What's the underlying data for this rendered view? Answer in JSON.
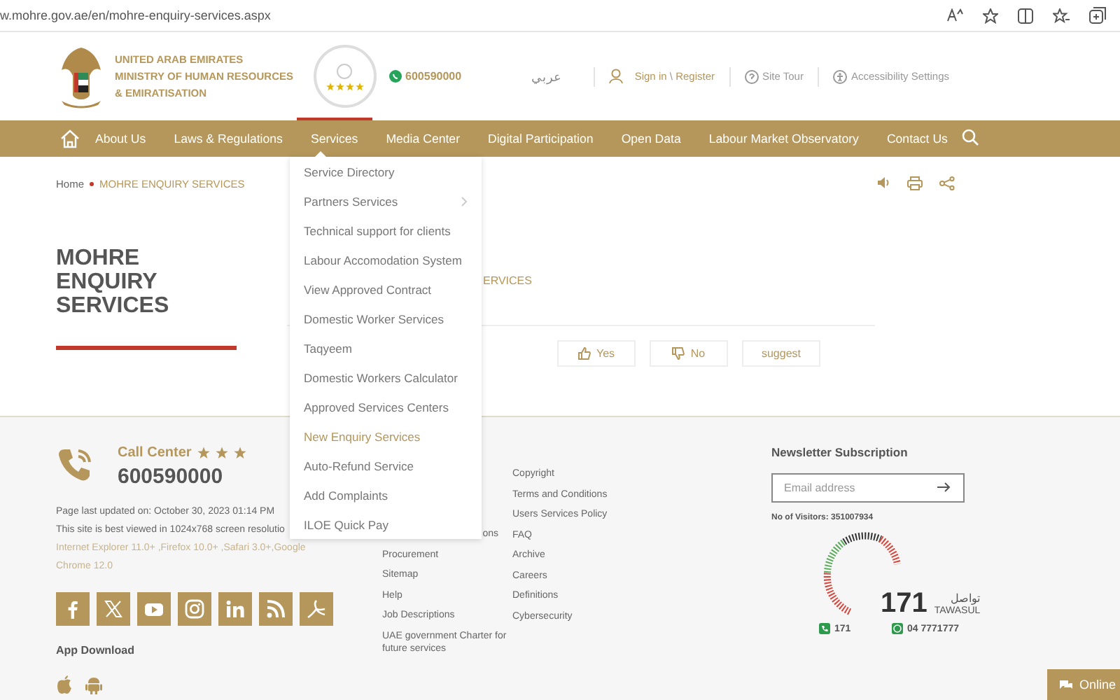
{
  "browser": {
    "url": "w.mohre.gov.ae/en/mohre-enquiry-services.aspx"
  },
  "header": {
    "ministry_lines": [
      "UNITED ARAB EMIRATES",
      "MINISTRY OF HUMAN RESOURCES",
      "& EMIRATISATION"
    ],
    "badge": {
      "stars": 4
    },
    "phone": "600590000",
    "language": "عربي",
    "sign_in": "Sign in",
    "separator": "\\",
    "register": "Register",
    "site_tour": "Site Tour",
    "accessibility": "Accessibility Settings"
  },
  "nav": {
    "items": [
      {
        "label": "About Us",
        "selected": false
      },
      {
        "label": "Laws & Regulations",
        "selected": false
      },
      {
        "label": "Services",
        "selected": true
      },
      {
        "label": "Media Center",
        "selected": false
      },
      {
        "label": "Digital Participation",
        "selected": false
      },
      {
        "label": "Open Data",
        "selected": false
      },
      {
        "label": "Labour Market Observatory",
        "selected": false
      },
      {
        "label": "Contact Us",
        "selected": false
      }
    ],
    "dropdown": [
      {
        "label": "Service Directory",
        "selected": false,
        "has_submenu": false
      },
      {
        "label": "Partners Services",
        "selected": false,
        "has_submenu": true
      },
      {
        "label": "Technical support for clients",
        "selected": false,
        "has_submenu": false
      },
      {
        "label": "Labour Accomodation System",
        "selected": false,
        "has_submenu": false
      },
      {
        "label": "View Approved Contract",
        "selected": false,
        "has_submenu": false
      },
      {
        "label": "Domestic Worker Services",
        "selected": false,
        "has_submenu": false
      },
      {
        "label": "Taqyeem",
        "selected": false,
        "has_submenu": false
      },
      {
        "label": "Domestic Workers Calculator",
        "selected": false,
        "has_submenu": false
      },
      {
        "label": "Approved Services Centers",
        "selected": false,
        "has_submenu": false
      },
      {
        "label": "New Enquiry Services",
        "selected": true,
        "has_submenu": false
      },
      {
        "label": "Auto-Refund Service",
        "selected": false,
        "has_submenu": false
      },
      {
        "label": "Add Complaints",
        "selected": false,
        "has_submenu": false
      },
      {
        "label": "ILOE Quick Pay",
        "selected": false,
        "has_submenu": false
      }
    ]
  },
  "breadcrumb": {
    "home": "Home",
    "current": "MOHRE ENQUIRY SERVICES"
  },
  "page": {
    "title_lines": [
      "MOHRE",
      "ENQUIRY",
      "SERVICES"
    ],
    "subtitle_tail": "ERVICES",
    "feedback": [
      {
        "kind": "yes",
        "label": "Yes"
      },
      {
        "kind": "no",
        "label": "No"
      },
      {
        "kind": "suggest",
        "label": "suggest"
      }
    ]
  },
  "footer": {
    "call_center": "Call Center",
    "stars": 3,
    "phone": "600590000",
    "updated": "Page last updated on: October 30, 2023 01:14 PM",
    "best_viewed": "This site is best viewed in 1024x768 screen resolutio",
    "browsers": "Internet Explorer 11.0+ ,Firefox 10.0+ ,Safari 3.0+,Google Chrome 12.0",
    "app_download": "App Download",
    "links_col1": [
      {
        "label": "ons",
        "kind": "tail"
      },
      {
        "label": "Procurement",
        "kind": "link"
      },
      {
        "label": "Sitemap",
        "kind": "link"
      },
      {
        "label": "Help",
        "kind": "link"
      },
      {
        "label": "Job Descriptions",
        "kind": "link"
      },
      {
        "label": "UAE government Charter for future services",
        "kind": "link"
      }
    ],
    "links_col2": [
      "Copyright",
      "Terms and Conditions",
      "Users Services Policy",
      "FAQ",
      "Archive",
      "Careers",
      "Definitions",
      "Cybersecurity"
    ],
    "newsletter": {
      "title": "Newsletter Subscription",
      "placeholder": "Email address"
    },
    "visitors": "No of Visitors: 351007934",
    "tawasul": {
      "number": "171",
      "arabic": "تواصل",
      "name": "TAWASUL",
      "phone": "171",
      "whatsapp": "04 7771777"
    }
  },
  "chat": {
    "label": "Online"
  }
}
